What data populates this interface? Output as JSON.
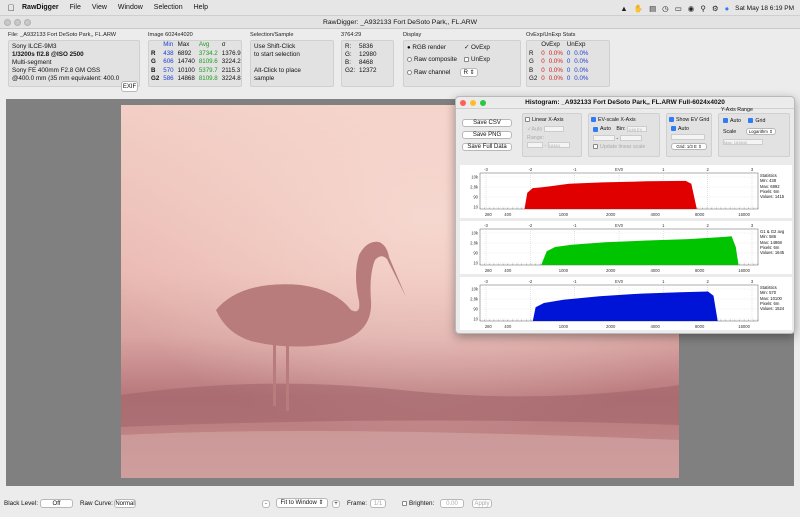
{
  "menubar": {
    "apple": "",
    "app": "RawDigger",
    "items": [
      "File",
      "View",
      "Window",
      "Selection",
      "Help"
    ],
    "datetime": "Sat May 18  6:19 PM"
  },
  "window": {
    "title": "RawDigger: _A932133 Fort DeSoto Park,, FL.ARW"
  },
  "file_panel": {
    "title": "File: _A932133 Fort DeSoto Park,, FL.ARW",
    "lines": [
      "Sony ILCE-9M3",
      "1/3200s f/2.8 @ISO 2500",
      "Multi-segment",
      "Sony FE 400mm F2.8 GM OSS",
      "@400.0 mm (35 mm equivalent: 400.0"
    ],
    "exif": "EXIF"
  },
  "image_panel": {
    "title": "Image 6024x4020",
    "headers": [
      "",
      "Min",
      "Max",
      "Avg",
      "σ"
    ],
    "rows": [
      {
        "ch": "R",
        "min": "438",
        "max": "6892",
        "avg": "3734.2",
        "sd": "1376.9"
      },
      {
        "ch": "G",
        "min": "606",
        "max": "14740",
        "avg": "8109.6",
        "sd": "3224.2"
      },
      {
        "ch": "B",
        "min": "570",
        "max": "10100",
        "avg": "5379.7",
        "sd": "2115.3"
      },
      {
        "ch": "G2",
        "min": "586",
        "max": "14868",
        "avg": "8109.8",
        "sd": "3224.8"
      }
    ]
  },
  "selection_panel": {
    "title": "Selection/Sample",
    "lines": [
      "Use Shift-Click",
      "to start selection",
      "",
      "Alt-Click to place",
      "sample"
    ]
  },
  "coord_panel": {
    "title": "3764:29",
    "rows": [
      {
        "k": "R:",
        "v": "5836"
      },
      {
        "k": "G:",
        "v": "12980"
      },
      {
        "k": "B:",
        "v": "8468"
      },
      {
        "k": "G2:",
        "v": "12372"
      }
    ]
  },
  "display_panel": {
    "title": "Display",
    "rgb_render": "RGB render",
    "raw_composite": "Raw composite",
    "raw_channel": "Raw channel",
    "channel_value": "R",
    "ovexp": "OvExp",
    "unexp": "UnExp"
  },
  "stats_panel": {
    "title": "OvExp/UnExp Stats",
    "headers": [
      "",
      "OvExp",
      "UnExp"
    ],
    "rows": [
      {
        "ch": "R",
        "ov": "0",
        "ovp": "0.0%",
        "un": "0",
        "unp": "0.0%"
      },
      {
        "ch": "G",
        "ov": "0",
        "ovp": "0.0%",
        "un": "0",
        "unp": "0.0%"
      },
      {
        "ch": "B",
        "ov": "0",
        "ovp": "0.0%",
        "un": "0",
        "unp": "0.0%"
      },
      {
        "ch": "G2",
        "ov": "0",
        "ovp": "0.0%",
        "un": "0",
        "unp": "0.0%"
      }
    ]
  },
  "bottom": {
    "black_level_label": "Black Level:",
    "black_level": "Off",
    "raw_curve_label": "Raw Curve:",
    "raw_curve": "Normal",
    "fit": "Fit to Window",
    "frame_label": "Frame:",
    "frame": "1/1",
    "brighten": "Brighten:",
    "brighten_val": "0.00",
    "apply": "Apply"
  },
  "histogram": {
    "title": "Histogram: _A932133 Fort DeSoto Park,, FL.ARW Full-6024x4020",
    "save_csv": "Save CSV",
    "save_png": "Save PNG",
    "save_full": "Save Full Data",
    "linear_x": "Linear X-Axis",
    "auto": "Auto",
    "range": "Range:",
    "range_val": "16384",
    "ev_scale": "EV-scale X-Axis",
    "bin": "Bin:",
    "bin_val": "1/48 EV",
    "update_linear": "Update linear scale",
    "show_ev_grid": "Show EV Grid",
    "grid_val": "Grid: 1/3 E",
    "y_range": "Y-Axis Range",
    "grid": "Grid",
    "scale": "Scale",
    "scale_val": "Logarithm",
    "max_label": "Max: 163840",
    "x_ticks": [
      "280",
      "400",
      "1000",
      "2000",
      "4000",
      "8000",
      "16000"
    ],
    "ev_ticks": [
      "-3",
      "-2",
      "-1",
      "EV0",
      "1",
      "2",
      "3"
    ],
    "y_ticks": [
      "10k",
      "2.8k",
      "90",
      "10"
    ],
    "channels": [
      {
        "name": "R",
        "color": "#e00000",
        "stats": [
          "Statistics",
          "Min: 438",
          "Max: 6892",
          "Pixels: 6m",
          "Values: 1415"
        ]
      },
      {
        "name": "G",
        "color": "#00c400",
        "stats": [
          "G1 & G2 avg",
          "Min: 586",
          "Max: 14868",
          "Pixels: 6m",
          "Values: 1645"
        ]
      },
      {
        "name": "B",
        "color": "#0014d8",
        "stats": [
          "Statistics",
          "Min: 570",
          "Max: 10100",
          "Pixels: 6m",
          "Values: 1524"
        ]
      }
    ]
  }
}
